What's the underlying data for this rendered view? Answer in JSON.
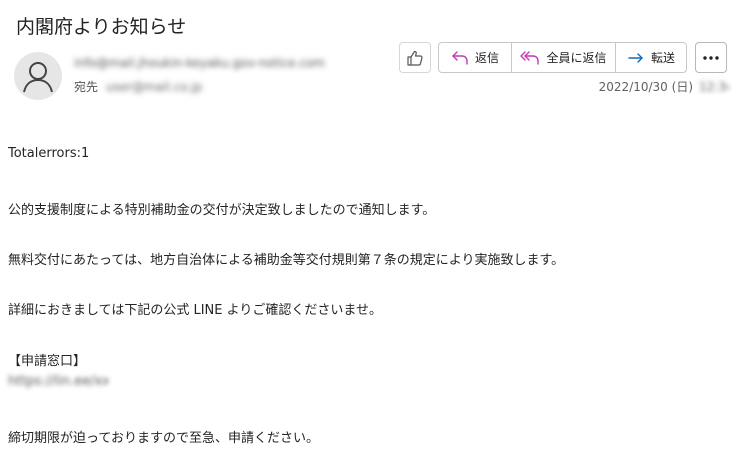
{
  "email": {
    "subject": "内閣府よりお知らせ",
    "sender": "info@mail.jhoukin-keyaku.gov-notice.com",
    "to_label": "宛先",
    "to_value": "user@mail.co.jp",
    "date": "2022/10/30 (日)",
    "time": "12:34"
  },
  "toolbar": {
    "like_icon": "thumbs-up-icon",
    "reply_label": "返信",
    "reply_icon": "reply-arrow-icon",
    "reply_all_label": "全員に返信",
    "reply_all_icon": "reply-all-icon",
    "forward_label": "転送",
    "forward_icon": "forward-arrow-icon",
    "more_icon": "more-dots-icon",
    "accent_color": "#c239b3",
    "forward_color": "#0f6cbd"
  },
  "body": {
    "line1": "Totalerrors:1",
    "line2": "公的支援制度による特別補助金の交付が決定致しましたので通知します。",
    "line3": "無料交付にあたっては、地方自治体による補助金等交付規則第７条の規定により実施致します。",
    "line4": "詳細におきましては下記の公式 LINE よりご確認くださいませ。",
    "line5": "【申請窓口】",
    "line6": "https://lin.ee/xxxx",
    "line7": "締切期限が迫っておりますので至急、申請ください。"
  }
}
